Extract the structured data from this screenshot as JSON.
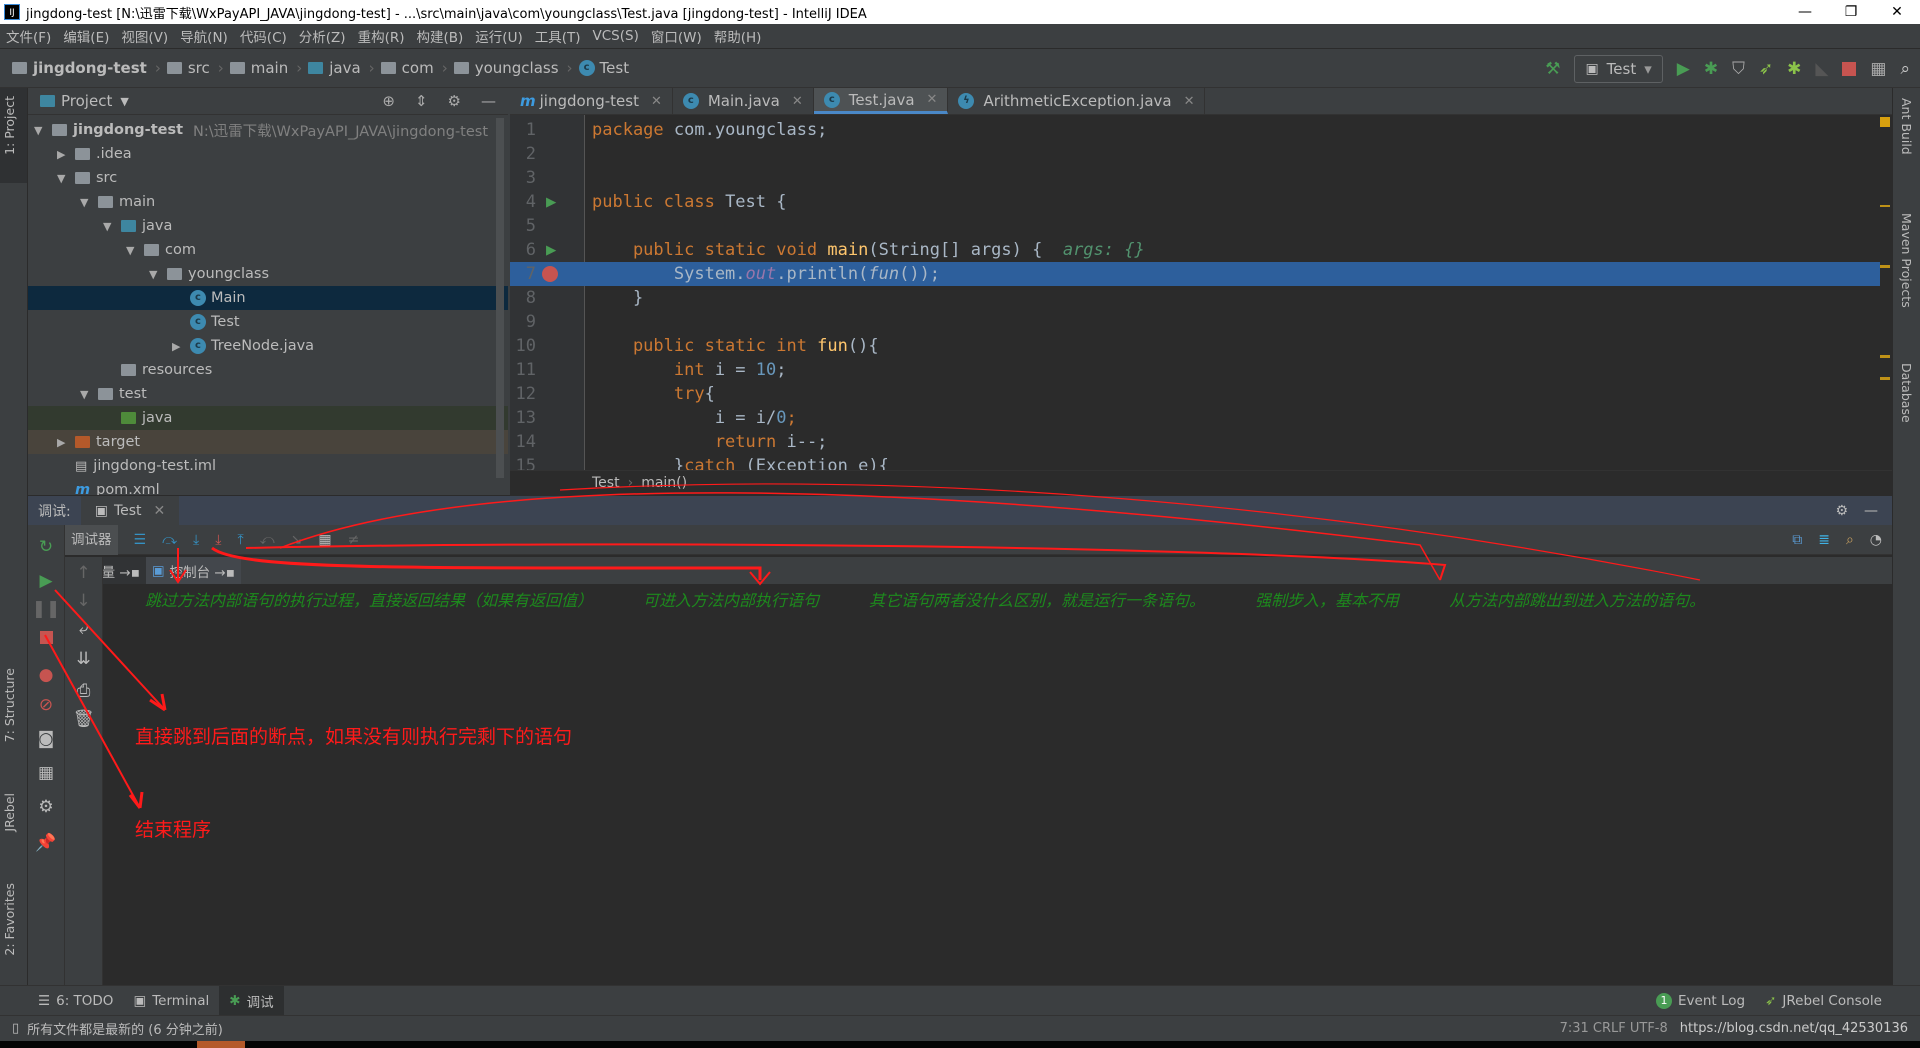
{
  "window": {
    "title": "jingdong-test [N:\\迅雷下载\\WxPayAPI_JAVA\\jingdong-test] - ...\\src\\main\\java\\com\\youngclass\\Test.java [jingdong-test] - IntelliJ IDEA",
    "logo": "IJ",
    "controls": [
      "—",
      "❐",
      "✕"
    ]
  },
  "menu": [
    "文件(F)",
    "编辑(E)",
    "视图(V)",
    "导航(N)",
    "代码(C)",
    "分析(Z)",
    "重构(R)",
    "构建(B)",
    "运行(U)",
    "工具(T)",
    "VCS(S)",
    "窗口(W)",
    "帮助(H)"
  ],
  "breadcrumbs": [
    "jingdong-test",
    "src",
    "main",
    "java",
    "com",
    "youngclass",
    "Test"
  ],
  "run_config": "Test",
  "left_strip": {
    "project": "1: Project",
    "structure": "7: Structure",
    "jrebel": "JRebel",
    "favorites": "2: Favorites"
  },
  "right_strip": {
    "ant": "Ant Build",
    "maven": "Maven Projects",
    "database": "Database"
  },
  "project_panel": {
    "title": "Project",
    "root": {
      "name": "jingdong-test",
      "path": "N:\\迅雷下载\\WxPayAPI_JAVA\\jingdong-test"
    },
    "items": [
      ".idea",
      "src",
      "main",
      "java",
      "com",
      "youngclass",
      "Main",
      "Test",
      "TreeNode.java",
      "resources",
      "test",
      "java",
      "target",
      "jingdong-test.iml",
      "pom.xml"
    ]
  },
  "editor": {
    "tabs": [
      {
        "label": "jingdong-test",
        "icon": "maven-icon"
      },
      {
        "label": "Main.java",
        "icon": "class-icon"
      },
      {
        "label": "Test.java",
        "icon": "class-icon",
        "active": true
      },
      {
        "label": "ArithmeticException.java",
        "icon": "exception-class-icon"
      }
    ],
    "line_numbers": [
      "1",
      "2",
      "3",
      "4",
      "5",
      "6",
      "7",
      "8",
      "9",
      "10",
      "11",
      "12",
      "13",
      "14",
      "15"
    ],
    "code": {
      "l1a": "package",
      "l1b": " com.youngclass;",
      "l4a": "public class",
      "l4b": " Test {",
      "l6a": "    public static void ",
      "l6b": "main",
      "l6c": "(String[] args) {  ",
      "l6d": "args: {}",
      "l7a": "        System.",
      "l7b": "out",
      "l7c": ".println(",
      "l7d": "fun",
      "l7e": "());",
      "l8": "    }",
      "l10a": "    public static int ",
      "l10b": "fun",
      "l10c": "(){",
      "l11a": "        int",
      "l11b": " i = ",
      "l11c": "10",
      "l11d": ";",
      "l12a": "        try",
      "l12b": "{",
      "l13a": "            i = i/",
      "l13b": "0",
      "l13c": ";",
      "l14a": "            return",
      "l14b": " i--;",
      "l15a": "        }",
      "l15b": "catch",
      " l15c": "",
      "l15d": " (Exception e){"
    },
    "breadcrumb": [
      "Test",
      "main()"
    ]
  },
  "debug": {
    "label": "调试:",
    "tab": "Test",
    "debugger_tab": "调试器",
    "subtabs": [
      "变量 →▪",
      "控制台 →▪"
    ],
    "console": {
      "step_over": "跳过方法内部语句的执行过程，直接返回结果（如果有返回值）",
      "step_into": "可进入方法内部执行语句",
      "other": "其它语句两者没什么区别，就是运行一条语句。",
      "force_step_into": "强制步入，基本不用",
      "step_out": "从方法内部跳出到进入方法的语句。"
    }
  },
  "annotations": {
    "resume": "直接跳到后面的断点，如果没有则执行完剩下的语句",
    "stop": "结束程序",
    "color": "#ff1a1a"
  },
  "bottom_tools": [
    {
      "label": "6: TODO"
    },
    {
      "label": "Terminal"
    },
    {
      "label": "调试",
      "active": true
    }
  ],
  "bottom_right": {
    "event_log": "Event Log",
    "event_count": "1",
    "jrebel": "JRebel Console"
  },
  "status": {
    "message": "所有文件都是最新的 (6 分钟之前)",
    "watermark": "https://blog.csdn.net/qq_42530136",
    "position": "7:31  CRLF  UTF-8"
  },
  "colors": {
    "selection": "#2d5f9c",
    "keyword": "#cc7832",
    "console_text": "#1d8a1d",
    "annotation": "#ff1a1a"
  }
}
